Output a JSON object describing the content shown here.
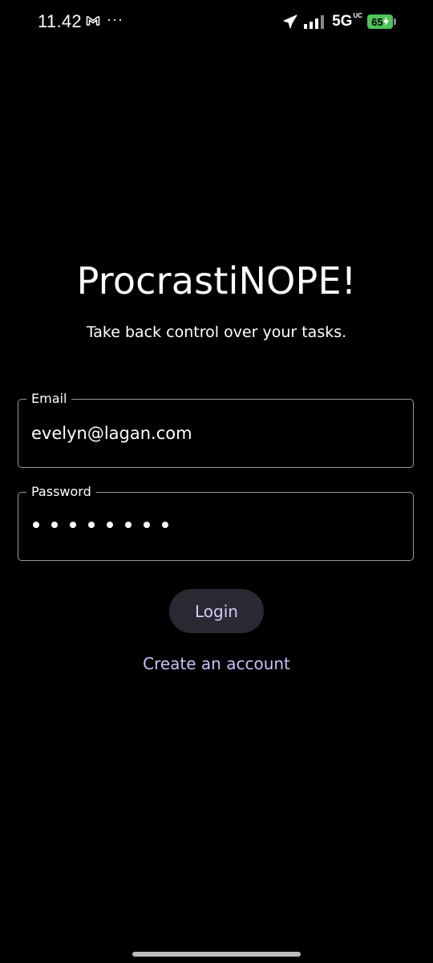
{
  "status_bar": {
    "time": "11.42",
    "notification_icons": [
      "gmail-icon",
      "more-dots-icon"
    ],
    "more_dots": "···",
    "network": "5G",
    "network_sup": "UC",
    "battery_level": "65",
    "battery_color": "#4fc25a",
    "icons": [
      "airplane-icon",
      "signal-icon",
      "battery-charging-icon"
    ]
  },
  "app": {
    "title": "ProcrastiNOPE!",
    "subtitle": "Take back control over your tasks."
  },
  "form": {
    "email_label": "Email",
    "email_value": "evelyn@lagan.com",
    "password_label": "Password",
    "password_masked_length": 8,
    "login_label": "Login",
    "create_account_label": "Create an account"
  },
  "colors": {
    "background": "#000000",
    "accent": "#cfbdfd",
    "button_bg": "#2a2830"
  }
}
